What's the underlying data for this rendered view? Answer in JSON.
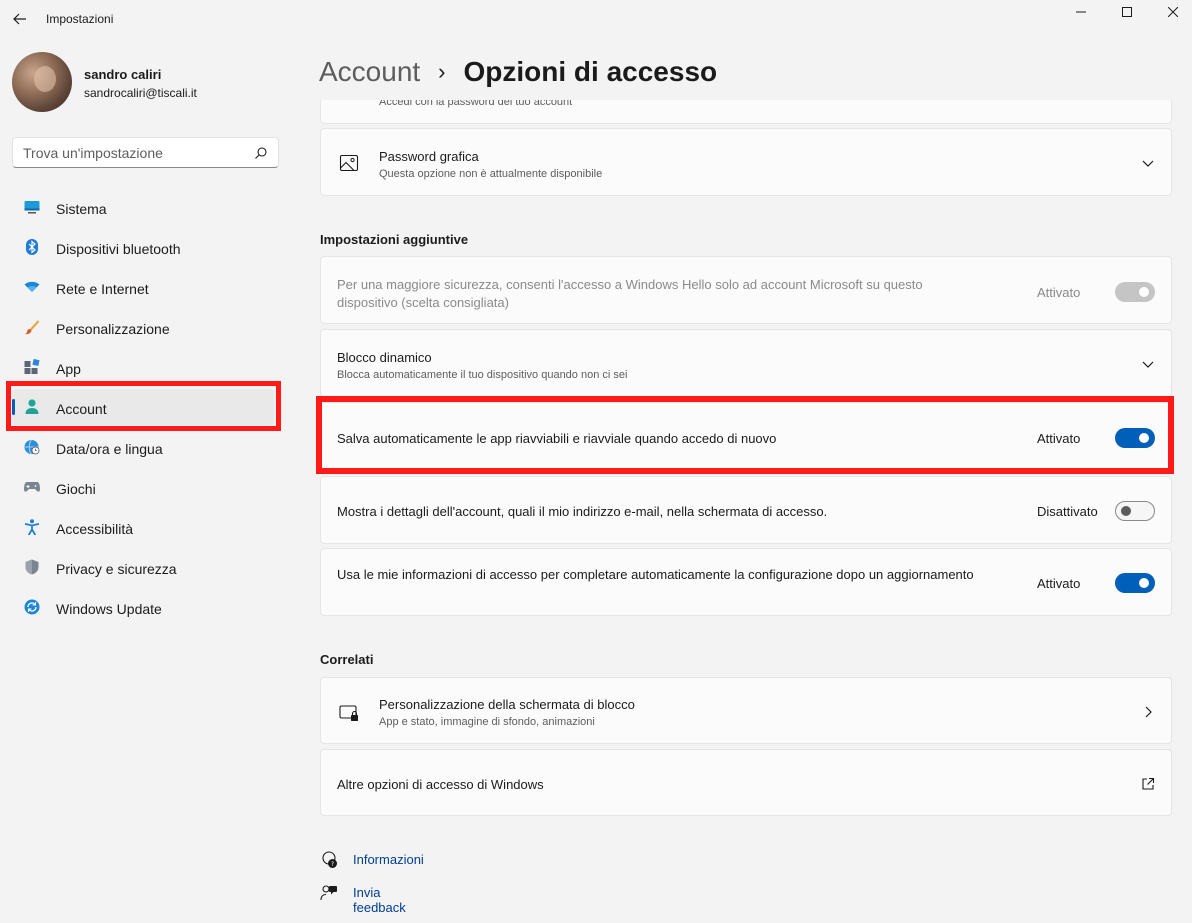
{
  "window": {
    "title": "Impostazioni"
  },
  "user": {
    "name": "sandro caliri",
    "email": "sandrocaliri@tiscali.it"
  },
  "search": {
    "placeholder": "Trova un'impostazione"
  },
  "nav": {
    "items": [
      {
        "label": "Sistema",
        "icon": "monitor-icon"
      },
      {
        "label": "Dispositivi bluetooth",
        "icon": "bluetooth-icon"
      },
      {
        "label": "Rete e Internet",
        "icon": "wifi-icon"
      },
      {
        "label": "Personalizzazione",
        "icon": "brush-icon"
      },
      {
        "label": "App",
        "icon": "apps-icon"
      },
      {
        "label": "Account",
        "icon": "person-icon",
        "active": true
      },
      {
        "label": "Data/ora e lingua",
        "icon": "globe-clock-icon"
      },
      {
        "label": "Giochi",
        "icon": "gamepad-icon"
      },
      {
        "label": "Accessibilità",
        "icon": "accessibility-icon"
      },
      {
        "label": "Privacy e sicurezza",
        "icon": "shield-icon"
      },
      {
        "label": "Windows Update",
        "icon": "update-icon"
      }
    ]
  },
  "breadcrumb": {
    "parent": "Account",
    "separator": "›",
    "current": "Opzioni di accesso"
  },
  "cards": {
    "password_partial_desc": "Accedi con la password del tuo account",
    "picture_password": {
      "title": "Password grafica",
      "desc": "Questa opzione non è attualmente disponibile"
    }
  },
  "additional": {
    "heading": "Impostazioni aggiuntive",
    "hello_only": {
      "title": "Per una maggiore sicurezza, consenti l'accesso a Windows Hello solo ad account Microsoft su questo dispositivo (scelta consigliata)",
      "state": "Attivato",
      "on": true,
      "disabled": true
    },
    "dynamic_lock": {
      "title": "Blocco dinamico",
      "desc": "Blocca automaticamente il tuo dispositivo quando non ci sei"
    },
    "restart_apps": {
      "title": "Salva automaticamente le app riavviabili e riavviale quando accedo di nuovo",
      "state": "Attivato",
      "on": true
    },
    "account_details": {
      "title": "Mostra i dettagli dell'account, quali il mio indirizzo e-mail, nella schermata di accesso.",
      "state": "Disattivato",
      "on": false
    },
    "use_signin_info": {
      "title": "Usa le mie informazioni di accesso per completare automaticamente la configurazione dopo un aggiornamento",
      "state": "Attivato",
      "on": true
    }
  },
  "related": {
    "heading": "Correlati",
    "lock_screen": {
      "title": "Personalizzazione della schermata di blocco",
      "desc": "App e stato, immagine di sfondo, animazioni"
    },
    "more_options": {
      "title": "Altre opzioni di accesso di Windows"
    }
  },
  "footer_links": {
    "help": "Informazioni",
    "feedback": "Invia feedback"
  },
  "colors": {
    "accent": "#005fb8",
    "highlight": "#ff1a1a",
    "background": "#f3f3f3",
    "card": "#fbfbfb"
  }
}
